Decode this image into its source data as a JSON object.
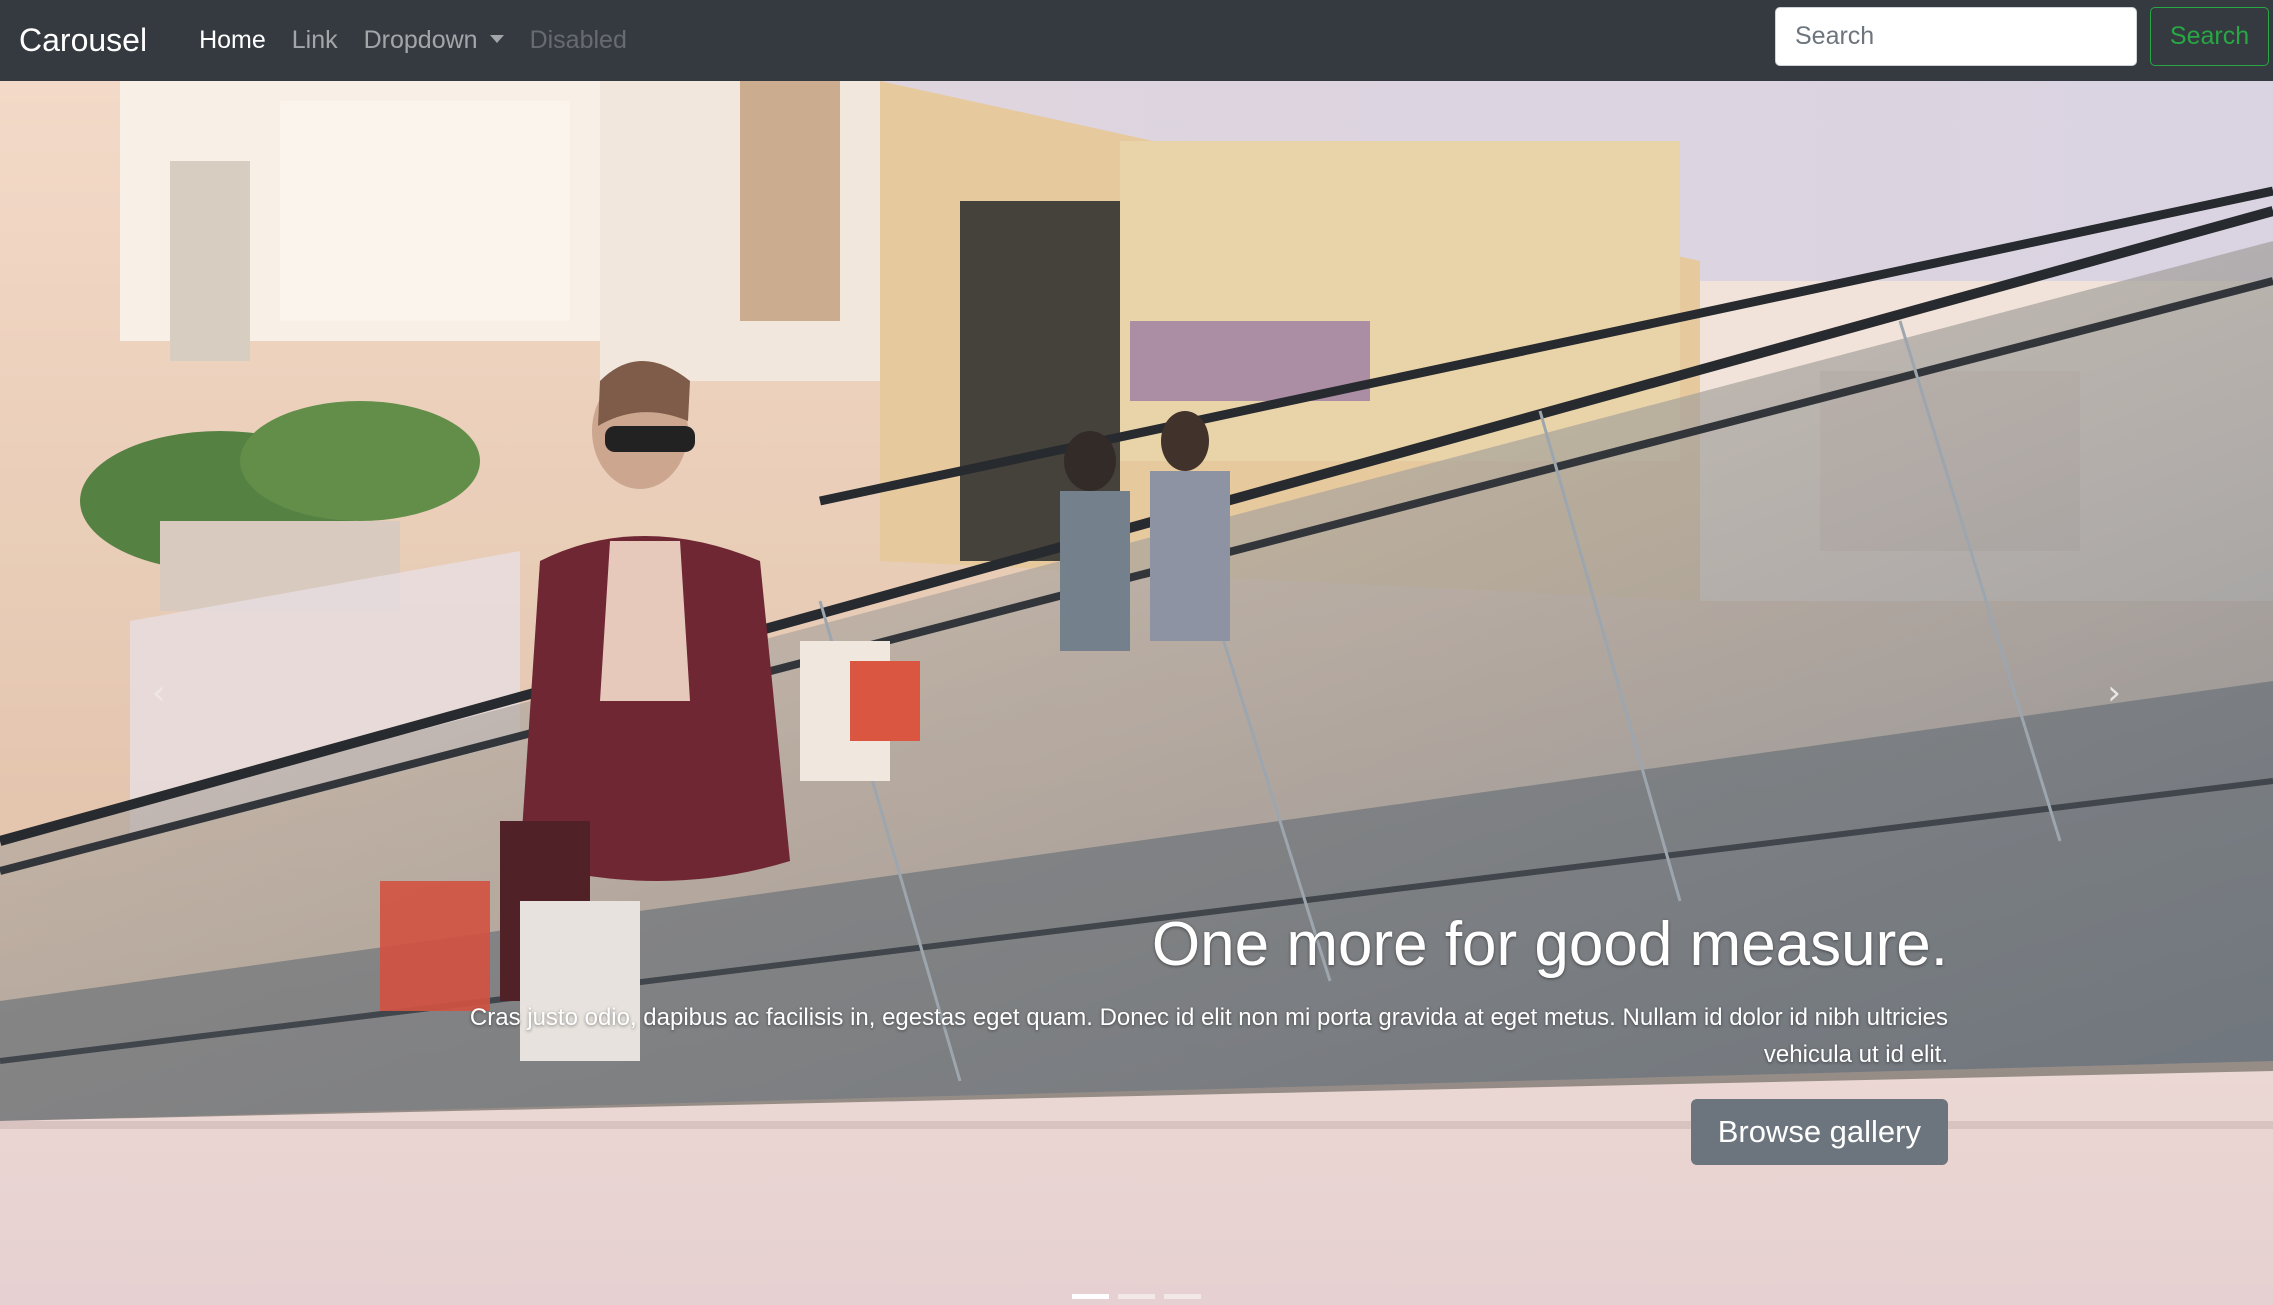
{
  "navbar": {
    "brand": "Carousel",
    "links": [
      {
        "label": "Home",
        "state": "active"
      },
      {
        "label": "Link",
        "state": "normal"
      },
      {
        "label": "Dropdown",
        "state": "dropdown"
      },
      {
        "label": "Disabled",
        "state": "disabled"
      }
    ],
    "search_placeholder": "Search",
    "search_button": "Search"
  },
  "carousel": {
    "slide_image": "escalator-mall-shopper-photo",
    "heading": "One more for good measure.",
    "text": "Cras justo odio, dapibus ac facilisis in, egestas eget quam. Donec id elit non mi porta gravida at eget metus. Nullam id dolor id nibh ultricies vehicula ut id elit.",
    "button": "Browse gallery",
    "prev_icon": "chevron-left-icon",
    "next_icon": "chevron-right-icon",
    "prev_glyph": "‹",
    "next_glyph": "›",
    "indicator_count": 3,
    "active_indicator": 1
  },
  "colors": {
    "navbar_bg": "#343a40",
    "search_accent": "#28a745",
    "button_secondary": "#6c757d"
  }
}
